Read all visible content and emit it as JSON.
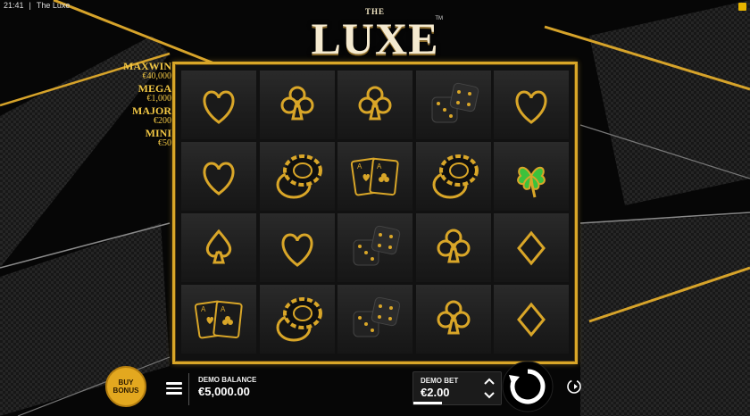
{
  "status_bar": {
    "time": "21:41",
    "separator": "|",
    "app_title": "The Luxe"
  },
  "logo": {
    "top": "THE",
    "main": "LUXE",
    "tm": "TM"
  },
  "jackpots": [
    {
      "name": "MAXWIN",
      "value": "€40,000"
    },
    {
      "name": "MEGA",
      "value": "€1,000"
    },
    {
      "name": "MAJOR",
      "value": "€200"
    },
    {
      "name": "MINI",
      "value": "€50"
    }
  ],
  "reels": [
    [
      "heart",
      "club",
      "club",
      "dice",
      "heart"
    ],
    [
      "heart",
      "chips",
      "cards",
      "chips",
      "clover"
    ],
    [
      "spade",
      "heart",
      "dice",
      "club",
      "diamond"
    ],
    [
      "cards",
      "chips",
      "dice",
      "club",
      "diamond"
    ]
  ],
  "controls": {
    "buy_bonus": "BUY BONUS",
    "balance_label": "DEMO BALANCE",
    "balance_value": "€5,000.00",
    "bet_label": "DEMO BET",
    "bet_value": "€2.00"
  },
  "colors": {
    "gold": "#d9a628",
    "bonus": "#e3a81f",
    "clover": "#3cc23c"
  },
  "icons": [
    "menu-icon",
    "chevron-up-icon",
    "chevron-down-icon",
    "spin-icon",
    "autoplay-icon"
  ]
}
